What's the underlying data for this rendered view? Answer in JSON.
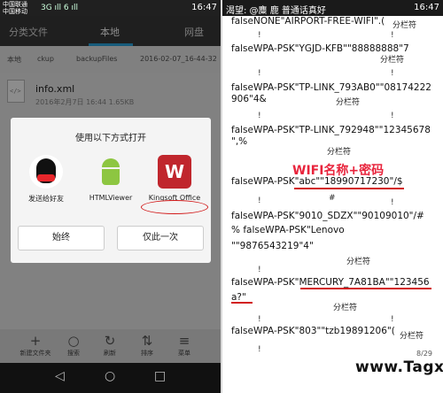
{
  "left": {
    "status": {
      "carrier1": "中国联通",
      "carrier2": "中国移动",
      "signal": "3G ıll 6 ıll",
      "time": "16:47"
    },
    "tabs": [
      {
        "label": "分类文件"
      },
      {
        "label": "本地"
      },
      {
        "label": "网盘"
      }
    ],
    "breadcrumb": [
      "本地",
      "ckup",
      "backupFiles",
      "2016-02-07_16-44-32"
    ],
    "file": {
      "name": "info.xml",
      "meta": "2016年2月7日 16:44 1.65KB"
    },
    "dialog": {
      "title": "使用以下方式打开",
      "apps": [
        {
          "label": "发送给好友"
        },
        {
          "label": "HTMLViewer"
        },
        {
          "label": "Kingsoft Office"
        }
      ],
      "buttons": {
        "always": "始终",
        "once": "仅此一次"
      }
    },
    "bottom_bar": [
      {
        "glyph": "+",
        "label": "新建文件夹"
      },
      {
        "glyph": "○",
        "label": "搜索"
      },
      {
        "glyph": "↻",
        "label": "刷新"
      },
      {
        "glyph": "⇅",
        "label": "排序"
      },
      {
        "glyph": "≡",
        "label": "菜单"
      }
    ],
    "nav": {
      "back": "◁",
      "home": "○",
      "recent": "□"
    }
  },
  "right": {
    "status": {
      "left": "渴望: @麋 鹿 普通话真好",
      "time": "16:47"
    },
    "lines": [
      "falseNONE\"AIRPORT-FREE-WIFI\".(",
      "falseWPA-PSK\"YGJD-KFB\"\"88888888\"7",
      "falseWPA-PSK\"TP-LINK_793AB0\"\"08174222",
      "906\"4&",
      "falseWPA-PSK\"TP-LINK_792948\"\"12345678",
      "\",%",
      "falseWPA-PSK\"abc\"\"18990717230\"/$",
      "#",
      "falseWPA-PSK\"9010_SDZX\"\"90109010\"/#",
      "%    falseWPA-PSK\"Lenovo",
      "\"\"9876543219\"4\"",
      "falseWPA-PSK\"MERCURY_7A81BA\"\"123456",
      "a?\"",
      "falseWPA-PSK\"803\"\"tzb19891206\"("
    ],
    "separator": "分栏符",
    "red_label": "WIFI名称+密码",
    "page": "8/29",
    "watermark": "www.Tagxp.com"
  }
}
